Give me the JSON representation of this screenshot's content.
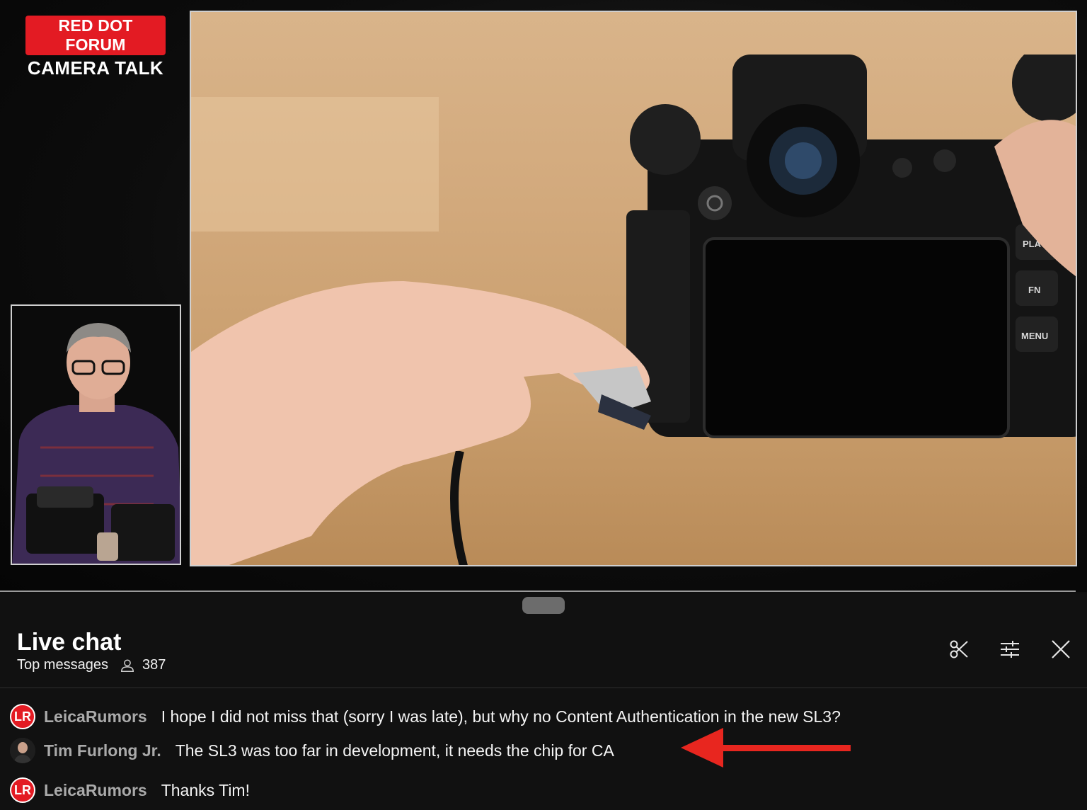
{
  "video": {
    "brand_line1": "RED DOT FORUM",
    "brand_line2": "CAMERA TALK",
    "camera_buttons": [
      "PLAY",
      "FN",
      "MENU"
    ]
  },
  "chat": {
    "title": "Live chat",
    "filter_label": "Top messages",
    "viewer_count": "387",
    "actions": [
      {
        "name": "clip-icon"
      },
      {
        "name": "settings-sliders-icon"
      },
      {
        "name": "close-icon"
      }
    ],
    "messages": [
      {
        "avatar_text": "LR",
        "author": "LeicaRumors",
        "text": "I hope I did not miss that (sorry I was late), but why no Content Authentication in the new SL3?"
      },
      {
        "avatar_text": "",
        "author": "Tim Furlong Jr.",
        "text": "The SL3 was too far in development, it needs the chip for CA"
      },
      {
        "avatar_text": "LR",
        "author": "LeicaRumors",
        "text": "Thanks Tim!"
      }
    ]
  },
  "colors": {
    "brand_red": "#e31b23",
    "annotation_arrow": "#e8261f",
    "chat_bg": "#111111"
  }
}
